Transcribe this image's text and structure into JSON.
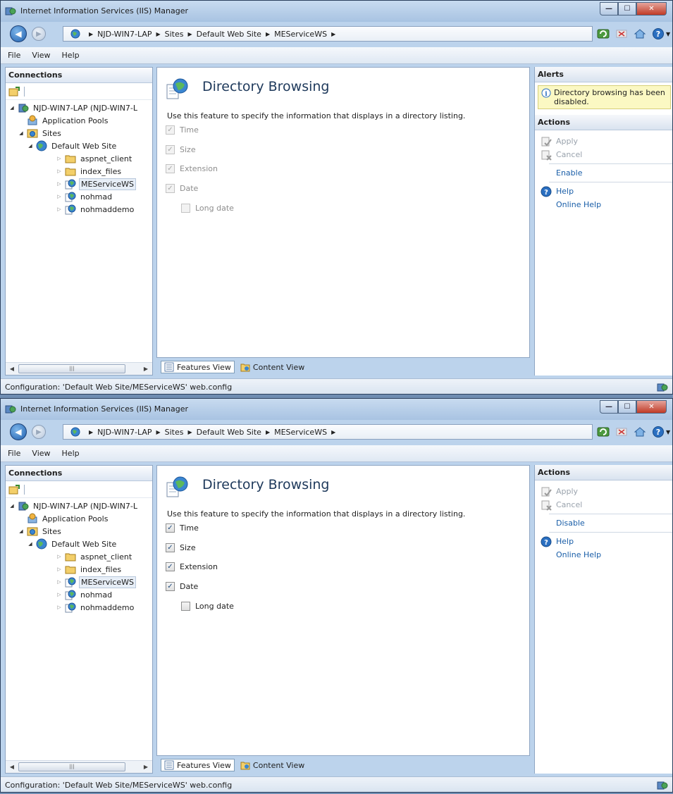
{
  "windows": [
    {
      "title": "Internet Information Services (IIS) Manager",
      "window_buttons": {
        "minimize": "—",
        "maximize": "☐",
        "close": "✕"
      },
      "breadcrumb": [
        "NJD-WIN7-LAP",
        "Sites",
        "Default Web Site",
        "MEServiceWS"
      ],
      "menu": [
        "File",
        "View",
        "Help"
      ],
      "connections": {
        "header": "Connections",
        "tree": [
          {
            "label": "NJD-WIN7-LAP (NJD-WIN7-L",
            "icon": "server-icon",
            "expander": "◢"
          },
          {
            "label": "Application Pools",
            "icon": "app-pools-icon",
            "expander": ""
          },
          {
            "label": "Sites",
            "icon": "sites-folder-icon",
            "expander": "◢"
          },
          {
            "label": "Default Web Site",
            "icon": "globe-icon",
            "expander": "◢"
          },
          {
            "label": "aspnet_client",
            "icon": "folder-icon",
            "expander": "▷"
          },
          {
            "label": "index_files",
            "icon": "folder-icon",
            "expander": "▷"
          },
          {
            "label": "MEServiceWS",
            "icon": "web-app-icon",
            "expander": "▷"
          },
          {
            "label": "nohmad",
            "icon": "web-app-icon",
            "expander": "▷"
          },
          {
            "label": "nohmaddemo",
            "icon": "web-app-icon",
            "expander": "▷"
          }
        ],
        "selected_index": 6,
        "scroll": {
          "left": "◀",
          "right": "▶",
          "thumb": "|||"
        }
      },
      "feature": {
        "title": "Directory Browsing",
        "description": "Use this feature to specify the information that displays in a directory listing.",
        "disabled": true,
        "checkboxes": [
          {
            "label": "Time",
            "checked": true
          },
          {
            "label": "Size",
            "checked": true
          },
          {
            "label": "Extension",
            "checked": true
          },
          {
            "label": "Date",
            "checked": true
          },
          {
            "label": "Long date",
            "checked": false
          }
        ],
        "check_glyph": "✓"
      },
      "views": {
        "features": "Features View",
        "content": "Content View"
      },
      "alerts": {
        "header": "Alerts",
        "message": "Directory browsing has been disabled."
      },
      "actions": {
        "header": "Actions",
        "apply": "Apply",
        "cancel": "Cancel",
        "toggle": "Enable",
        "help": "Help",
        "online_help": "Online Help"
      },
      "status": "Configuration: 'Default Web Site/MEServiceWS' web.config"
    },
    {
      "title": "Internet Information Services (IIS) Manager",
      "window_buttons": {
        "minimize": "—",
        "maximize": "☐",
        "close": "✕"
      },
      "breadcrumb": [
        "NJD-WIN7-LAP",
        "Sites",
        "Default Web Site",
        "MEServiceWS"
      ],
      "menu": [
        "File",
        "View",
        "Help"
      ],
      "connections": {
        "header": "Connections",
        "tree": [
          {
            "label": "NJD-WIN7-LAP (NJD-WIN7-L",
            "icon": "server-icon",
            "expander": "◢"
          },
          {
            "label": "Application Pools",
            "icon": "app-pools-icon",
            "expander": ""
          },
          {
            "label": "Sites",
            "icon": "sites-folder-icon",
            "expander": "◢"
          },
          {
            "label": "Default Web Site",
            "icon": "globe-icon",
            "expander": "◢"
          },
          {
            "label": "aspnet_client",
            "icon": "folder-icon",
            "expander": "▷"
          },
          {
            "label": "index_files",
            "icon": "folder-icon",
            "expander": "▷"
          },
          {
            "label": "MEServiceWS",
            "icon": "web-app-icon",
            "expander": "▷"
          },
          {
            "label": "nohmad",
            "icon": "web-app-icon",
            "expander": "▷"
          },
          {
            "label": "nohmaddemo",
            "icon": "web-app-icon",
            "expander": "▷"
          }
        ],
        "selected_index": 6,
        "scroll": {
          "left": "◀",
          "right": "▶",
          "thumb": "|||"
        }
      },
      "feature": {
        "title": "Directory Browsing",
        "description": "Use this feature to specify the information that displays in a directory listing.",
        "disabled": false,
        "checkboxes": [
          {
            "label": "Time",
            "checked": true
          },
          {
            "label": "Size",
            "checked": true
          },
          {
            "label": "Extension",
            "checked": true
          },
          {
            "label": "Date",
            "checked": true
          },
          {
            "label": "Long date",
            "checked": false
          }
        ],
        "check_glyph": "✓"
      },
      "views": {
        "features": "Features View",
        "content": "Content View"
      },
      "actions": {
        "header": "Actions",
        "apply": "Apply",
        "cancel": "Cancel",
        "toggle": "Disable",
        "help": "Help",
        "online_help": "Online Help"
      },
      "status": "Configuration: 'Default Web Site/MEServiceWS' web.config"
    }
  ]
}
